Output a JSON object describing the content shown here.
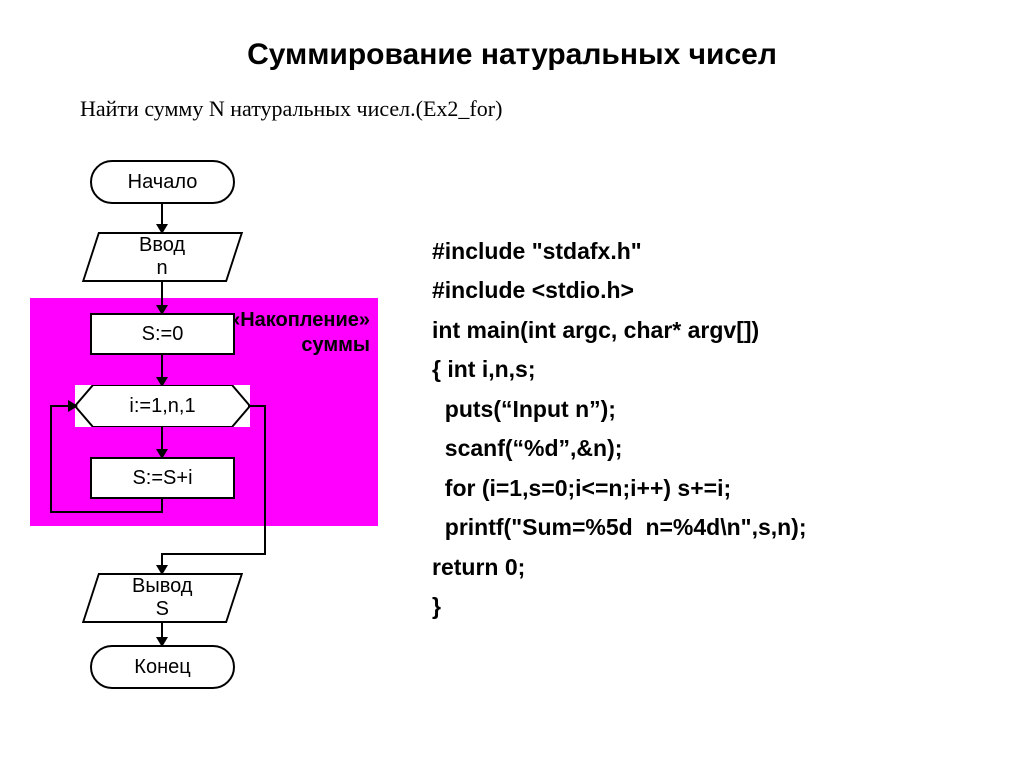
{
  "title": "Суммирование натуральных чисел",
  "subtitle": "Найти сумму N натуральных чисел.(Ex2_for)",
  "flow": {
    "start": "Начало",
    "input": "Ввод\nn",
    "init": "S:=0",
    "accum_label1": "«Накопление»",
    "accum_label2": "суммы",
    "loop": "i:=1,n,1",
    "body": "S:=S+i",
    "output": "Вывод\nS",
    "end": "Конец"
  },
  "code": {
    "l1": "#include \"stdafx.h\"",
    "l2": "#include <stdio.h>",
    "l3": "int main(int argc, char* argv[])",
    "l4": "{ int i,n,s;",
    "l5": "  puts(“Input n”);",
    "l6": "  scanf(“%d”,&n);",
    "l7": "  for (i=1,s=0;i<=n;i++) s+=i;",
    "l8": "  printf(\"Sum=%5d  n=%4d\\n\",s,n);",
    "l9": "return 0;",
    "l10": "}"
  }
}
